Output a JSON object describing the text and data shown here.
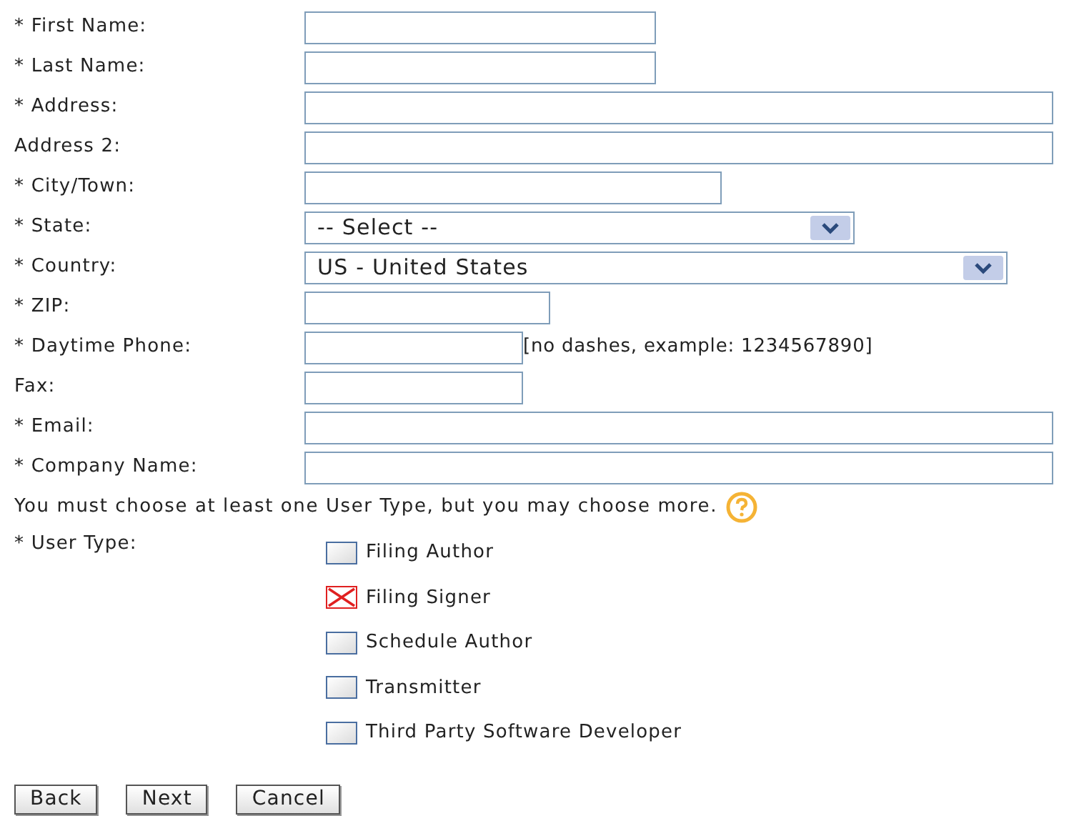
{
  "fields": [
    {
      "label": "* First Name:",
      "kind": "text"
    },
    {
      "label": "* Last Name:",
      "kind": "text"
    },
    {
      "label": "* Address:",
      "kind": "text"
    },
    {
      "label": "Address 2:",
      "kind": "text"
    },
    {
      "label": "* City/Town:",
      "kind": "text"
    },
    {
      "label": "* State:",
      "kind": "select",
      "value": "-- Select --"
    },
    {
      "label": "* Country:",
      "kind": "select",
      "value": "US - United States"
    },
    {
      "label": "* ZIP:",
      "kind": "text"
    },
    {
      "label": "* Daytime Phone:",
      "kind": "text",
      "hint": "[no dashes, example: 1234567890]"
    },
    {
      "label": "Fax:",
      "kind": "text"
    },
    {
      "label": "* Email:",
      "kind": "text"
    },
    {
      "label": "* Company Name:",
      "kind": "text"
    }
  ],
  "user_type_note": "You must choose at least one User Type, but you may choose more.",
  "user_type_label": "* User Type:",
  "user_types": [
    {
      "label": "Filing Author",
      "checked": false
    },
    {
      "label": "Filing Signer",
      "checked": true
    },
    {
      "label": "Schedule Author",
      "checked": false
    },
    {
      "label": "Transmitter",
      "checked": false
    },
    {
      "label": "Third Party Software Developer",
      "checked": false
    }
  ],
  "buttons": [
    "Back",
    "Next",
    "Cancel"
  ]
}
